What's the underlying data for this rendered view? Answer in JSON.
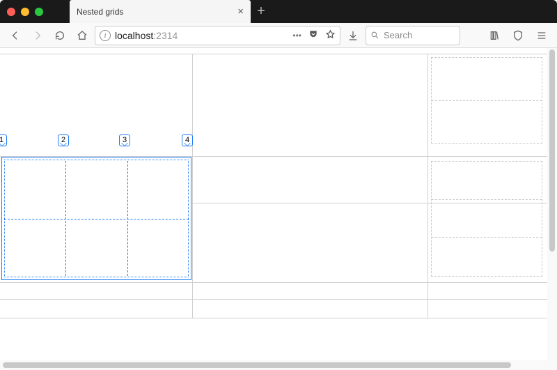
{
  "window": {
    "tab_title": "Nested grids"
  },
  "toolbar": {
    "url_host": "localhost",
    "url_port": ":2314",
    "search_placeholder": "Search"
  },
  "grid_labels": {
    "l1": "1",
    "l2": "2",
    "l3": "3",
    "l4": "4"
  }
}
